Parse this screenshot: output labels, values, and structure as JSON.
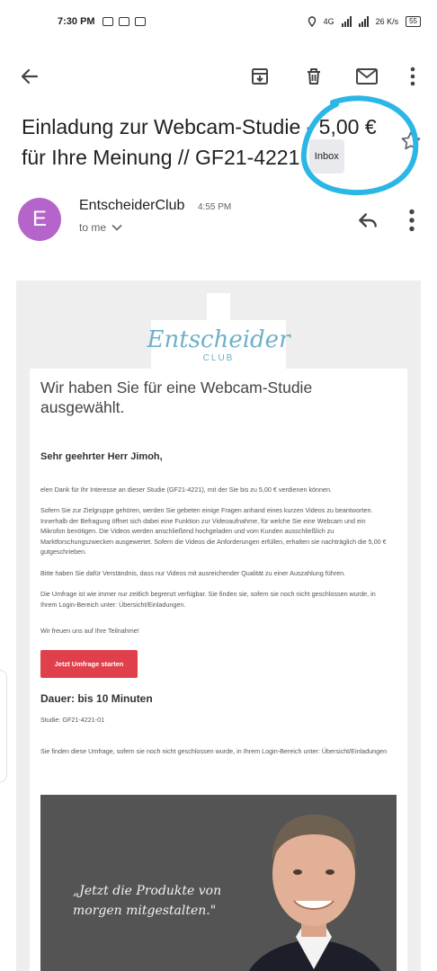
{
  "status_bar": {
    "time": "7:30 PM",
    "network_type": "4G",
    "data_rate": "26 K/s",
    "battery": "55"
  },
  "email": {
    "subject": "Einladung zur Webcam-Studie - 5,00 € für Ihre Meinung // GF21-4221",
    "label": "Inbox",
    "sender": "EntscheiderClub",
    "sender_initial": "E",
    "time": "4:55 PM",
    "recipient": "to me"
  },
  "body": {
    "logo_main": "Entscheider",
    "logo_sub": "CLUB",
    "headline": "Wir haben Sie für eine Webcam-Studie ausgewählt.",
    "greeting": "Sehr geehrter Herr Jimoh,",
    "p1": "elen Dank für Ihr Interesse an dieser Studie (GF21-4221), mit der Sie bis zu 5,00 € verdienen können.",
    "p2": "Sofern Sie zur Zielgruppe gehören, werden Sie gebeten einige Fragen anhand eines kurzen Videos zu beantworten. Innerhalb der Befragung öffnet sich dabei eine Funktion zur Videoaufnahme, für welche Sie eine Webcam und ein Mikrofon benötigen. Die Videos werden anschließend hochgeladen und vom Kunden ausschließlich zu Marktforschungszwecken ausgewertet. Sofern die Videos die Anforderungen erfüllen, erhalten sie nachträglich die 5,00 € gutgeschrieben.",
    "p3": "Bitte haben Sie dafür Verständnis, dass nur Videos mit ausreichender Qualität zu einer Auszahlung führen.",
    "p4": "Die Umfrage ist wie immer nur zeitlich begrenzt verfügbar. Sie finden sie, sofern sie noch nicht geschlossen wurde, in Ihrem Login-Bereich unter: Übersicht/Einladungen.",
    "p5": "Wir freuen uns auf Ihre Teilnahme!",
    "cta": "Jetzt Umfrage starten",
    "duration": "Dauer: bis 10 Minuten",
    "study_id": "Studie: GF21-4221-01",
    "p6": "Sie finden diese Umfrage, sofern sie noch nicht geschlossen wurde, in Ihrem Login-Bereich unter: Übersicht/Einladungen",
    "quote": "„Jetzt die Produkte von morgen mitgestalten.\""
  },
  "colors": {
    "avatar": "#b565c9",
    "cta": "#e0404c",
    "logo": "#6fb0c8",
    "annotation": "#2bb7e6"
  }
}
